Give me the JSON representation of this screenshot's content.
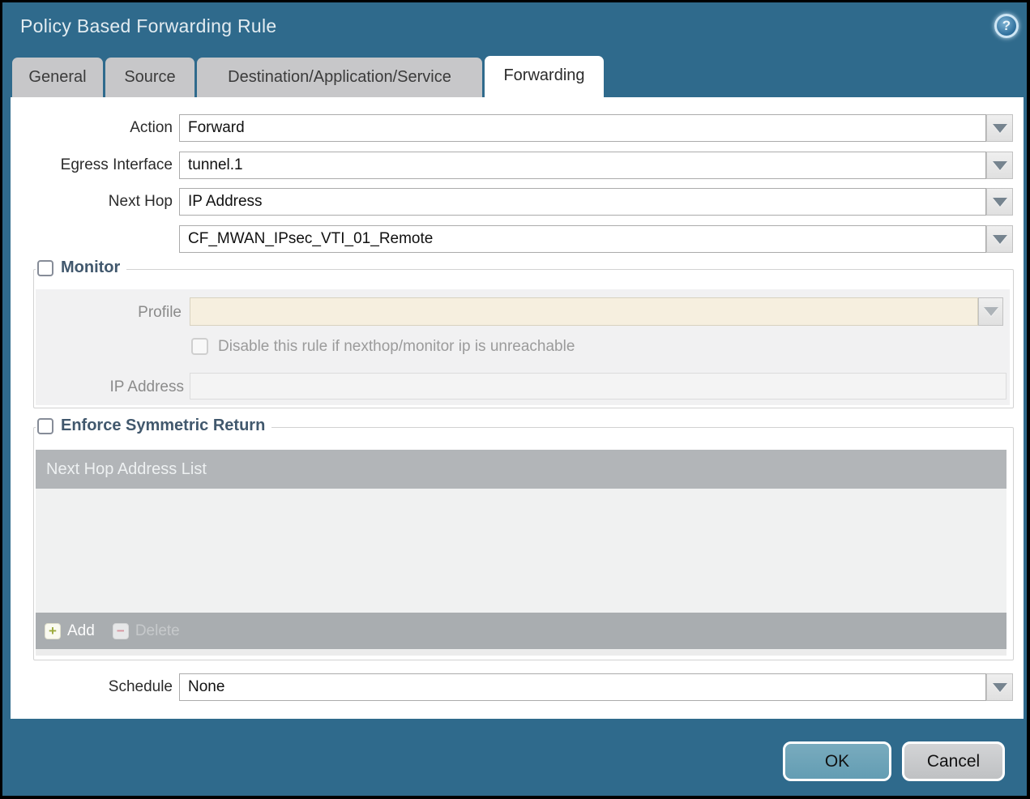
{
  "dialog": {
    "title": "Policy Based Forwarding Rule"
  },
  "icons": {
    "help": "?",
    "add_plus": "+",
    "delete_minus": "−"
  },
  "tabs": [
    {
      "label": "General",
      "active": false
    },
    {
      "label": "Source",
      "active": false
    },
    {
      "label": "Destination/Application/Service",
      "active": false
    },
    {
      "label": "Forwarding",
      "active": true
    }
  ],
  "form": {
    "action": {
      "label": "Action",
      "value": "Forward"
    },
    "egress_interface": {
      "label": "Egress Interface",
      "value": "tunnel.1"
    },
    "next_hop": {
      "label": "Next Hop",
      "value": "IP Address"
    },
    "next_hop_address": {
      "value": "CF_MWAN_IPsec_VTI_01_Remote"
    },
    "schedule": {
      "label": "Schedule",
      "value": "None"
    }
  },
  "monitor": {
    "legend": "Monitor",
    "checked": false,
    "profile": {
      "label": "Profile",
      "value": ""
    },
    "disable_rule": {
      "label": "Disable this rule if nexthop/monitor ip is unreachable",
      "checked": false
    },
    "ip_address": {
      "label": "IP Address",
      "value": ""
    }
  },
  "symmetric_return": {
    "legend": "Enforce Symmetric Return",
    "checked": false,
    "table": {
      "header": "Next Hop Address List",
      "rows": []
    },
    "add_label": "Add",
    "delete_label": "Delete"
  },
  "footer": {
    "ok_label": "OK",
    "cancel_label": "Cancel"
  },
  "colors": {
    "titlebar_teal": "#2f6a8c",
    "active_field_cream": "#f6efdf",
    "table_header_gray": "#b2b5b8",
    "ok_button_blue": "#6da4b8"
  }
}
